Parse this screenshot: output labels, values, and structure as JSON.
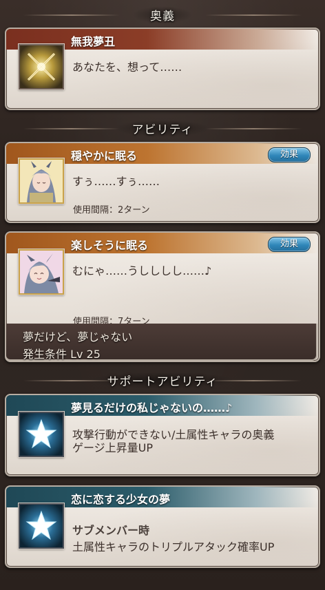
{
  "sections": {
    "ougi": "奥義",
    "ability": "アビリティ",
    "support": "サポートアビリティ"
  },
  "ougi_card": {
    "name": "無我夢丑",
    "desc": "あなたを、想って……",
    "icon": "crossed-swords-icon"
  },
  "abilities": [
    {
      "name": "穏やかに眠る",
      "desc": "すぅ……すぅ……",
      "cooldown": "使用間隔：2ターン",
      "effect_label": "効果",
      "icon": "sleeping-character-icon"
    },
    {
      "name": "楽しそうに眠る",
      "desc": "むにゃ……うしししし……♪",
      "cooldown": "使用間隔：7ターン",
      "effect_label": "効果",
      "icon": "happy-sleeping-character-icon",
      "unlock_line1": "夢だけど、夢じゃない",
      "unlock_line2": "発生条件 Lv 25"
    }
  ],
  "support": [
    {
      "name": "夢見るだけの私じゃないの……♪",
      "desc_line1": "攻撃行動ができない/土属性キャラの奥義",
      "desc_line2": "ゲージ上昇量UP",
      "icon": "star-icon"
    },
    {
      "name": "恋に恋する少女の夢",
      "subtitle": "サブメンバー時",
      "desc": "土属性キャラのトリプルアタック確率UP",
      "icon": "star-icon"
    }
  ],
  "colors": {
    "ougi_header": "#7a2f1f",
    "ability_header": "#a0571d",
    "support_header": "#1f4856",
    "effect_button": "#2f86b9"
  }
}
